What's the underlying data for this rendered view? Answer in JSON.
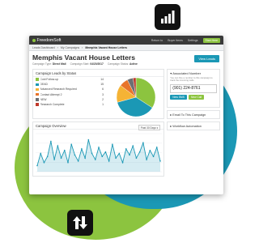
{
  "app": {
    "logo_text": "FreedomSoft"
  },
  "topnav": {
    "items": [
      "Return to",
      "Buyer Items",
      "Settings"
    ],
    "start_label": "Start Here"
  },
  "breadcrumb": [
    "Leads Dashboard",
    "My Campaigns",
    "Memphis Vacant House Letters"
  ],
  "page": {
    "title": "Memphis Vacant House Letters",
    "meta": [
      {
        "label": "Campaign Type:",
        "value": "Direct Mail"
      },
      {
        "label": "Campaign Start:",
        "value": "04/20/2017"
      },
      {
        "label": "Campaign Status:",
        "value": "Active"
      }
    ],
    "view_leads_label": "View Leads"
  },
  "leads_panel": {
    "title": "Campaign Leads by Status"
  },
  "chart_data": [
    {
      "type": "pie",
      "title": "Campaign Leads by Status",
      "categories": [
        "Cold Follow-up",
        "DEAD",
        "Advanced Research Required",
        "Contact Attempt 2",
        "NEW",
        "Research Complete"
      ],
      "values": [
        14,
        15,
        6,
        3,
        2,
        1
      ],
      "colors": [
        "#8cc43f",
        "#1b98b5",
        "#f5b335",
        "#e8742a",
        "#6b6f73",
        "#c0392b"
      ]
    },
    {
      "type": "area",
      "title": "Campaign Overview",
      "y": [
        4,
        12,
        6,
        10,
        20,
        8,
        17,
        9,
        14,
        6,
        18,
        11,
        7,
        15,
        9,
        21,
        12,
        8,
        16,
        10,
        13,
        7,
        18,
        9,
        12,
        6,
        15,
        11,
        17,
        9,
        13,
        19,
        8,
        14,
        10,
        16,
        7
      ],
      "ylim": [
        0,
        25
      ],
      "color": "#1b98b5"
    }
  ],
  "overview_panel": {
    "title": "Campaign Overview",
    "range_label": "Past 30 Days"
  },
  "associated": {
    "title": "Associated Number",
    "description": "You can hire a number to this campaign to track the incoming calls.",
    "phone": "(901) 224-8761",
    "new_sms_label": "New SMS",
    "new_call_label": "New Call"
  },
  "side_rows": [
    "Email To This Campaign",
    "Workflow Automation"
  ]
}
